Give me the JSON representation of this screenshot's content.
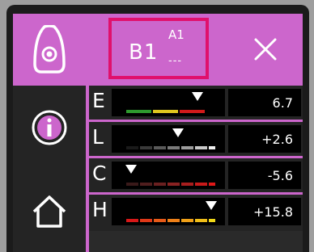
{
  "header": {
    "measure_main": "B1",
    "measure_sup": "A1",
    "measure_dashes": "---"
  },
  "sidebar": {
    "items": [
      {
        "icon": "device-sensor-icon"
      },
      {
        "icon": "info-icon"
      },
      {
        "icon": "home-icon"
      }
    ]
  },
  "rows": [
    {
      "letter": "E",
      "value": "6.7",
      "marker_pct": 0.75
    },
    {
      "letter": "L",
      "value": "+2.6",
      "marker_pct": 0.55
    },
    {
      "letter": "C",
      "value": "-5.6",
      "marker_pct": 0.18
    },
    {
      "letter": "H",
      "value": "+15.8",
      "marker_pct": 0.92
    }
  ],
  "colors": {
    "accent": "#cc66cc",
    "highlight": "#e0106c",
    "panel": "#242424"
  }
}
